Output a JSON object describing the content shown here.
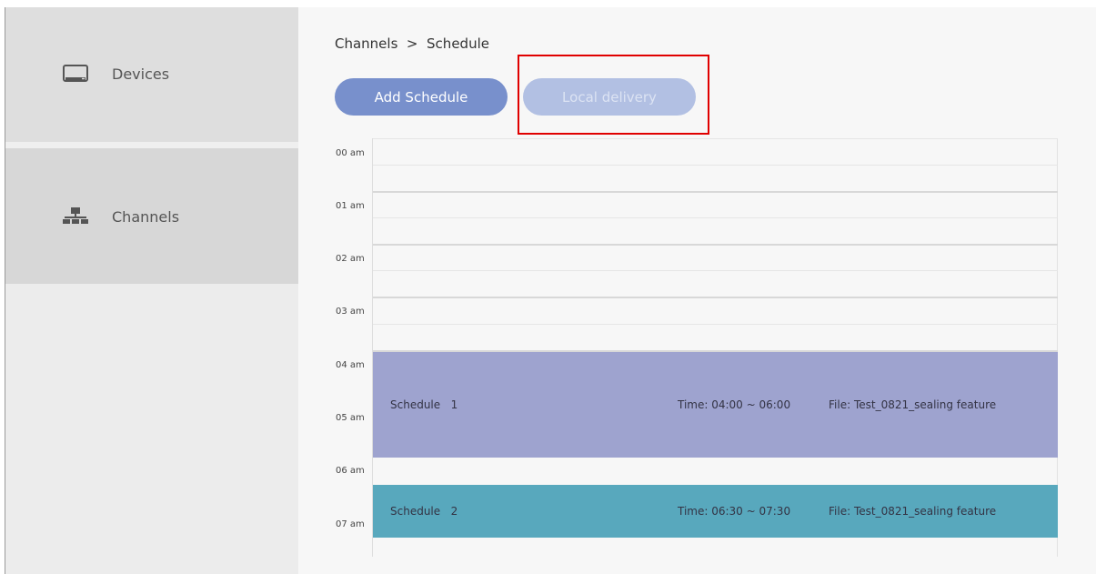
{
  "sidebar": {
    "items": [
      {
        "label": "Devices",
        "icon": "monitor-icon"
      },
      {
        "label": "Channels",
        "icon": "network-icon"
      }
    ]
  },
  "breadcrumb": {
    "text": "Channels  >  Schedule"
  },
  "toolbar": {
    "add_label": "Add Schedule",
    "local_label": "Local delivery"
  },
  "calendar": {
    "hours": [
      "00 am",
      "01 am",
      "02 am",
      "03 am",
      "04 am",
      "05 am",
      "06 am",
      "07 am"
    ],
    "events": [
      {
        "name": "Schedule   1",
        "time": "Time: 04:00 ~ 06:00",
        "file": "File: Test_0821_sealing feature",
        "color": "#9ea3cf"
      },
      {
        "name": "Schedule   2",
        "time": "Time: 06:30 ~ 07:30",
        "file": "File: Test_0821_sealing feature",
        "color": "#58a8bd"
      }
    ]
  },
  "colors": {
    "accent": "#7890cc",
    "highlight": "#e00000"
  }
}
